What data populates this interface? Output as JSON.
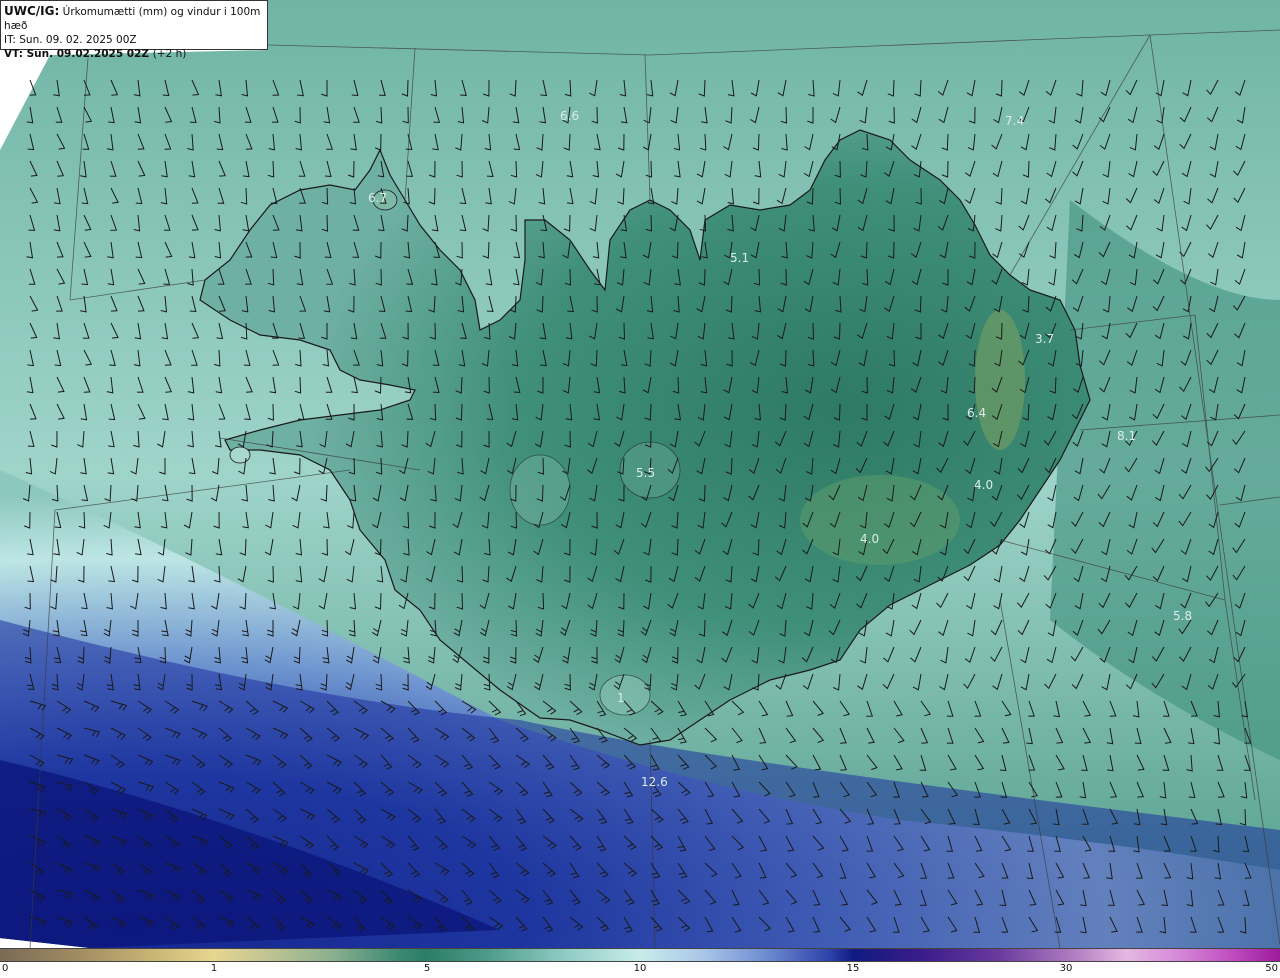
{
  "header": {
    "model": "UWC/IG:",
    "title": "Úrkomumætti (mm) og vindur i 100m hæð",
    "init_prefix": "IT:",
    "init_value": "Sun. 09. 02. 2025 00Z",
    "valid_prefix": "VT: Sun. 09.02.2025 02Z",
    "valid_suffix": "(+2 h)"
  },
  "map_values": [
    {
      "label": "6.6",
      "x": "approx-west-north-sea"
    },
    {
      "label": "7.4"
    },
    {
      "label": "6.7"
    },
    {
      "label": "5.1"
    },
    {
      "label": "3.7"
    },
    {
      "label": "6.4"
    },
    {
      "label": "8.1"
    },
    {
      "label": "5.5"
    },
    {
      "label": "4.0"
    },
    {
      "label": "4.0"
    },
    {
      "label": "5.8"
    },
    {
      "label": "1"
    },
    {
      "label": "12.6"
    }
  ],
  "colorbar": {
    "ticks": [
      "0",
      "1",
      "5",
      "10",
      "15",
      "30",
      "50"
    ]
  },
  "colors": {
    "sea_blue": "#1a2a90",
    "land_green": "#3e8a73",
    "light_cyan": "#c9ecea",
    "outline": "#1a1a1a"
  }
}
